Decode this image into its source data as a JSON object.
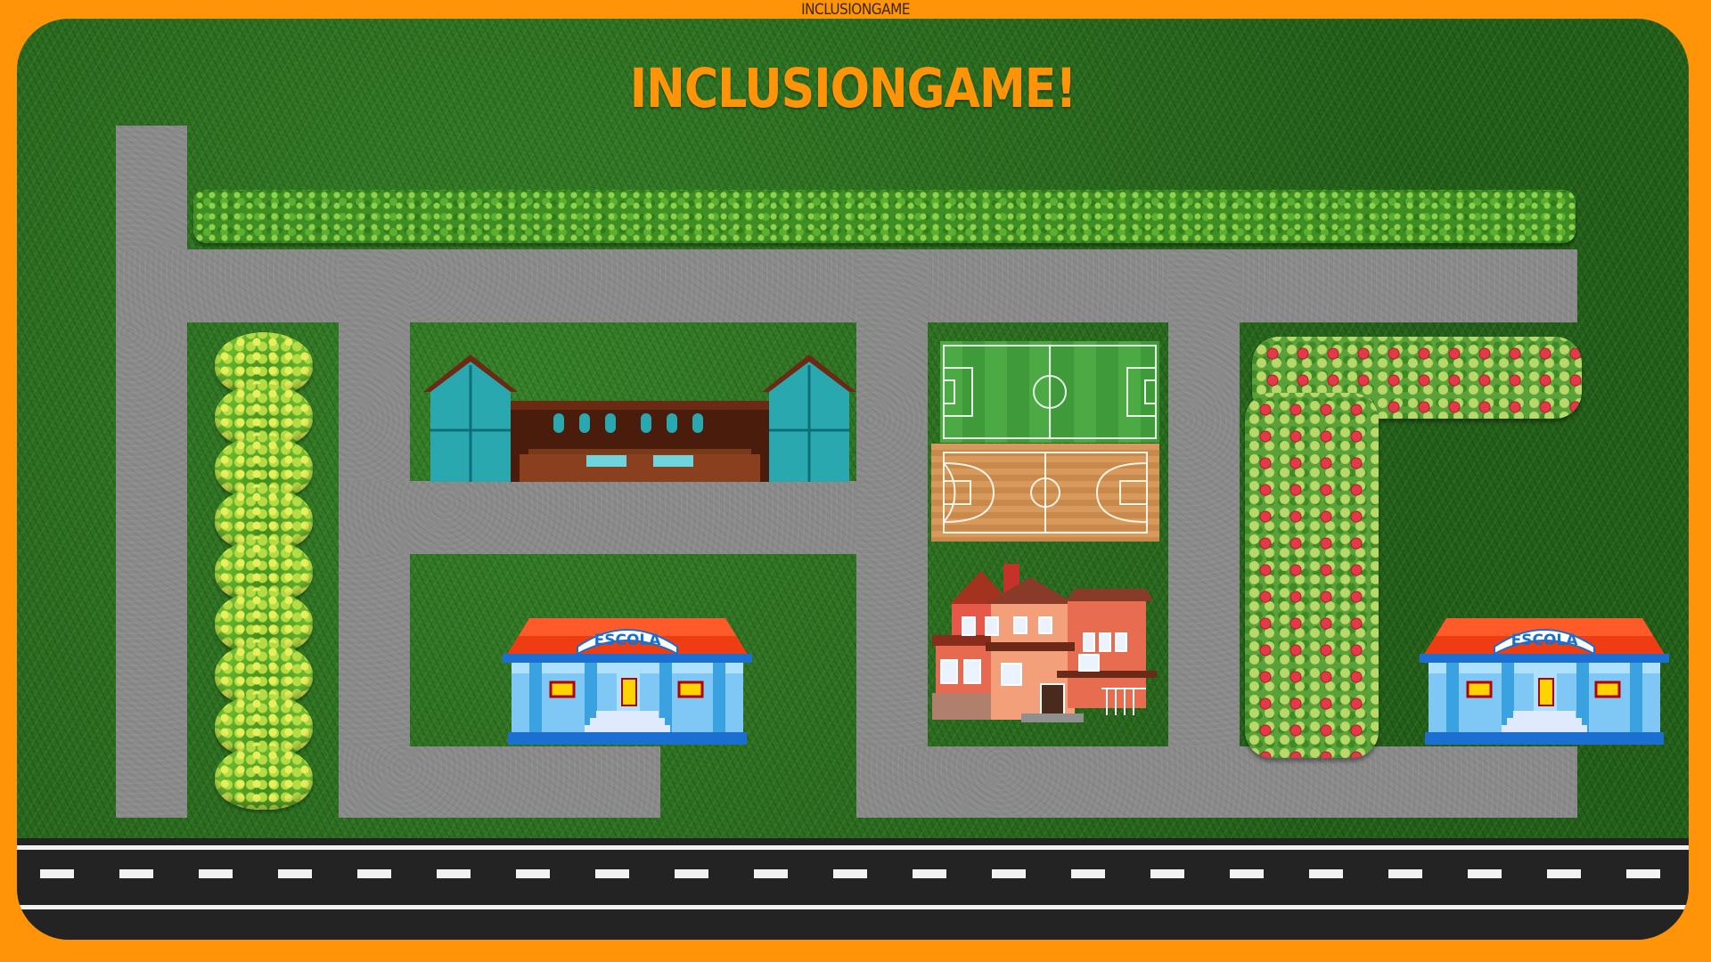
{
  "window": {
    "title": "INCLUSIONGAME"
  },
  "game": {
    "title": "INCLUSIONGAME!"
  },
  "buildings": {
    "school_sign": "ESCOLA"
  },
  "colors": {
    "frame": "#ff9408",
    "title": "#ff9408",
    "grass": "#2a6a1e",
    "path": "#8a8a8a",
    "road": "#232323",
    "school_roof": "#ee3d12",
    "school_wall": "#7fc8f5"
  },
  "icons": [
    "gym-building-icon",
    "soccer-field-icon",
    "basketball-court-icon",
    "house-icon",
    "school-icon",
    "hedge-icon",
    "bush-icon",
    "rose-bush-icon"
  ]
}
